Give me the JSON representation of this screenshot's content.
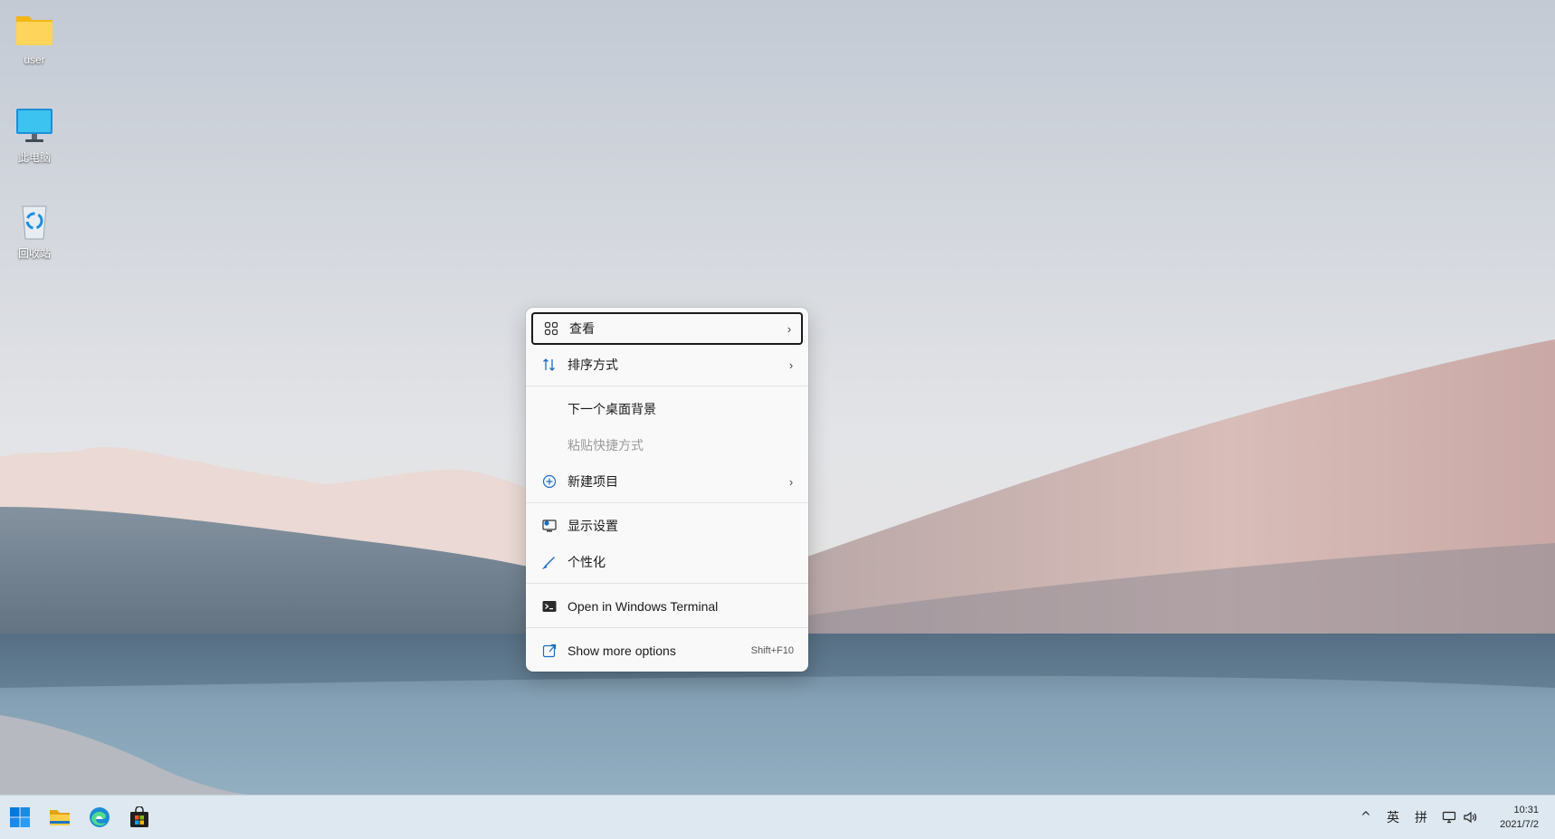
{
  "desktop": {
    "icons": [
      {
        "label": "user",
        "icon": "folder-icon"
      },
      {
        "label": "此电脑",
        "icon": "computer-icon"
      },
      {
        "label": "回收站",
        "icon": "recycle-bin-icon"
      }
    ]
  },
  "context_menu": {
    "items": [
      {
        "label": "查看",
        "icon": "view-grid-icon",
        "submenu": true
      },
      {
        "label": "排序方式",
        "icon": "sort-icon",
        "submenu": true
      },
      {
        "label": "下一个桌面背景",
        "icon": ""
      },
      {
        "label": "粘贴快捷方式",
        "icon": "",
        "disabled": true
      },
      {
        "label": "新建项目",
        "icon": "new-item-plus-icon",
        "submenu": true
      },
      {
        "label": "显示设置",
        "icon": "display-settings-icon"
      },
      {
        "label": "个性化",
        "icon": "brush-icon"
      },
      {
        "label": "Open in Windows Terminal",
        "icon": "terminal-icon"
      },
      {
        "label": "Show more options",
        "icon": "more-options-icon",
        "shortcut": "Shift+F10"
      }
    ]
  },
  "taskbar": {
    "apps": [
      "start-icon",
      "file-explorer-icon",
      "edge-icon",
      "store-icon"
    ],
    "tray": {
      "chevron": "^",
      "lang": "英",
      "ime": "拼"
    },
    "clock": {
      "time": "10:31",
      "date": "2021/7/2"
    }
  },
  "colors": {
    "accent": "#0078d4",
    "taskbar": "#dde8f1",
    "menu_bg": "#f9f9f9"
  }
}
